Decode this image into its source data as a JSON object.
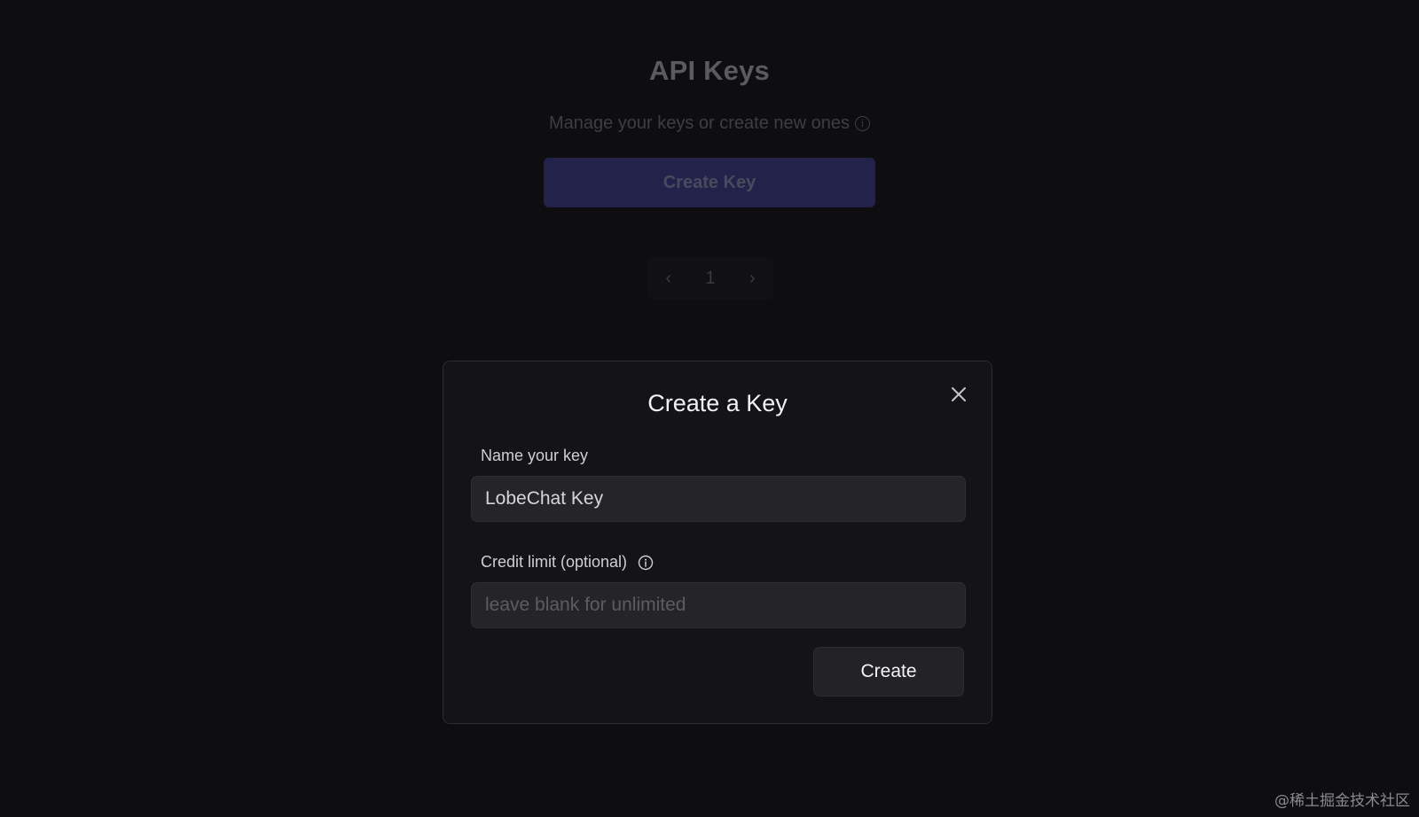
{
  "background": {
    "title": "API Keys",
    "subtitle": "Manage your keys or create new ones",
    "create_key_label": "Create Key",
    "pagination": {
      "prev": "‹",
      "current_page": "1",
      "next": "›"
    }
  },
  "modal": {
    "title": "Create a Key",
    "name_label": "Name your key",
    "name_value": "LobeChat Key",
    "credit_label": "Credit limit (optional)",
    "credit_placeholder": "leave blank for unlimited",
    "create_label": "Create"
  },
  "watermark": "@稀土掘金技术社区",
  "colors": {
    "accent_button_bg": "#22224a",
    "modal_bg": "#141416",
    "page_bg": "#0e0e10"
  }
}
